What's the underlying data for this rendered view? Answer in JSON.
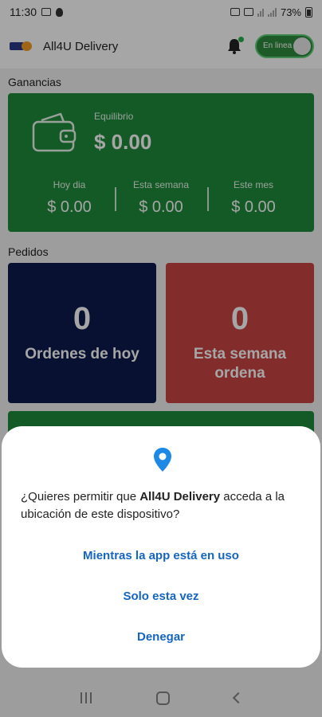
{
  "status_bar": {
    "time": "11:30",
    "battery": "73%"
  },
  "header": {
    "app_name": "All4U Delivery",
    "online_toggle_label": "En linea"
  },
  "earnings": {
    "section_title": "Ganancias",
    "balance_label": "Equilibrio",
    "balance_value": "$ 0.00",
    "today_label": "Hoy dia",
    "today_value": "$ 0.00",
    "week_label": "Esta semana",
    "week_value": "$ 0.00",
    "month_label": "Este mes",
    "month_value": "$ 0.00"
  },
  "orders": {
    "section_title": "Pedidos",
    "today_count": "0",
    "today_label": "Ordenes de hoy",
    "week_count": "0",
    "week_label": "Esta semana ordena"
  },
  "permission_dialog": {
    "message_prefix": "¿Quieres permitir que ",
    "app_name": "All4U Delivery",
    "message_suffix": " acceda a la ubicación de este dispositivo?",
    "option_while_using": "Mientras la app está en uso",
    "option_only_once": "Solo esta vez",
    "option_deny": "Denegar"
  },
  "colors": {
    "green": "#1f8b3b",
    "navy": "#0d1b4c",
    "red": "#c84444",
    "link_blue": "#1565c0"
  }
}
